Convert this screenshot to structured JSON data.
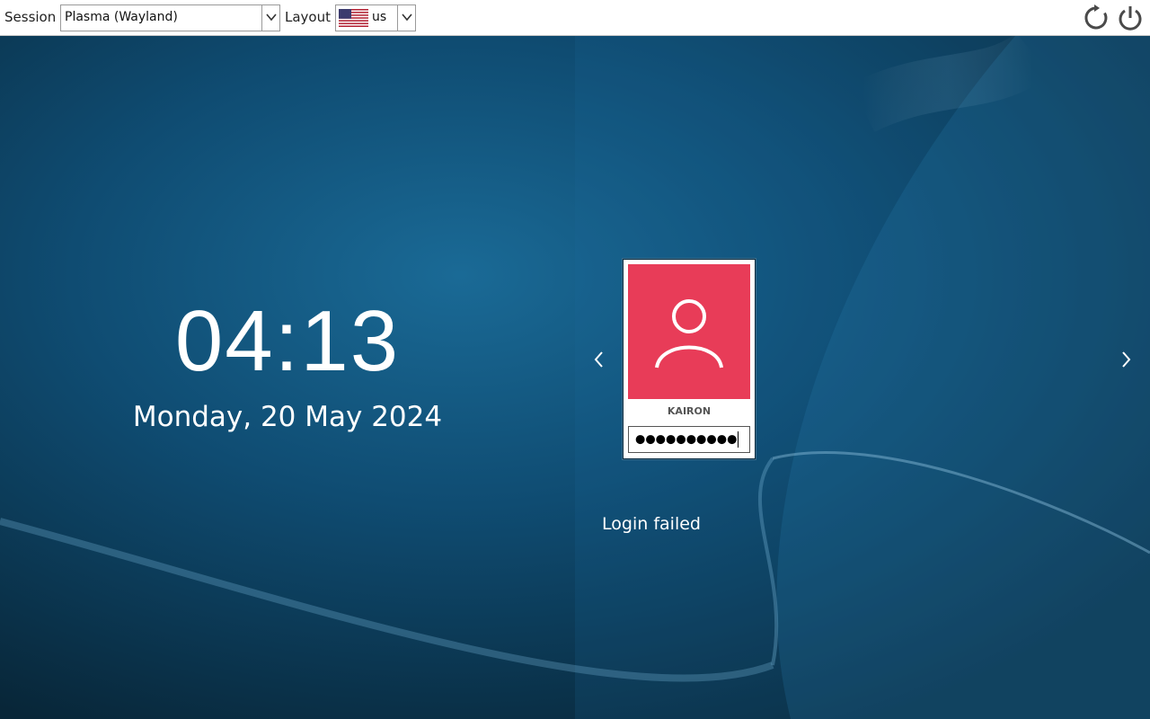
{
  "topbar": {
    "session_label": "Session",
    "session_value": "Plasma (Wayland)",
    "layout_label": "Layout",
    "layout_value": "us",
    "layout_flag": "us-flag-icon",
    "reboot_icon": "reboot-icon",
    "power_icon": "power-icon"
  },
  "clock": {
    "time": "04:13",
    "date": "Monday, 20 May 2024"
  },
  "login": {
    "username": "KAIRON",
    "password_mask": "●●●●●●●●●●",
    "avatar_color": "#e83c58",
    "avatar_icon": "user-icon",
    "prev_icon": "chevron-left-icon",
    "next_icon": "chevron-right-icon"
  },
  "status": {
    "message": "Login failed"
  }
}
